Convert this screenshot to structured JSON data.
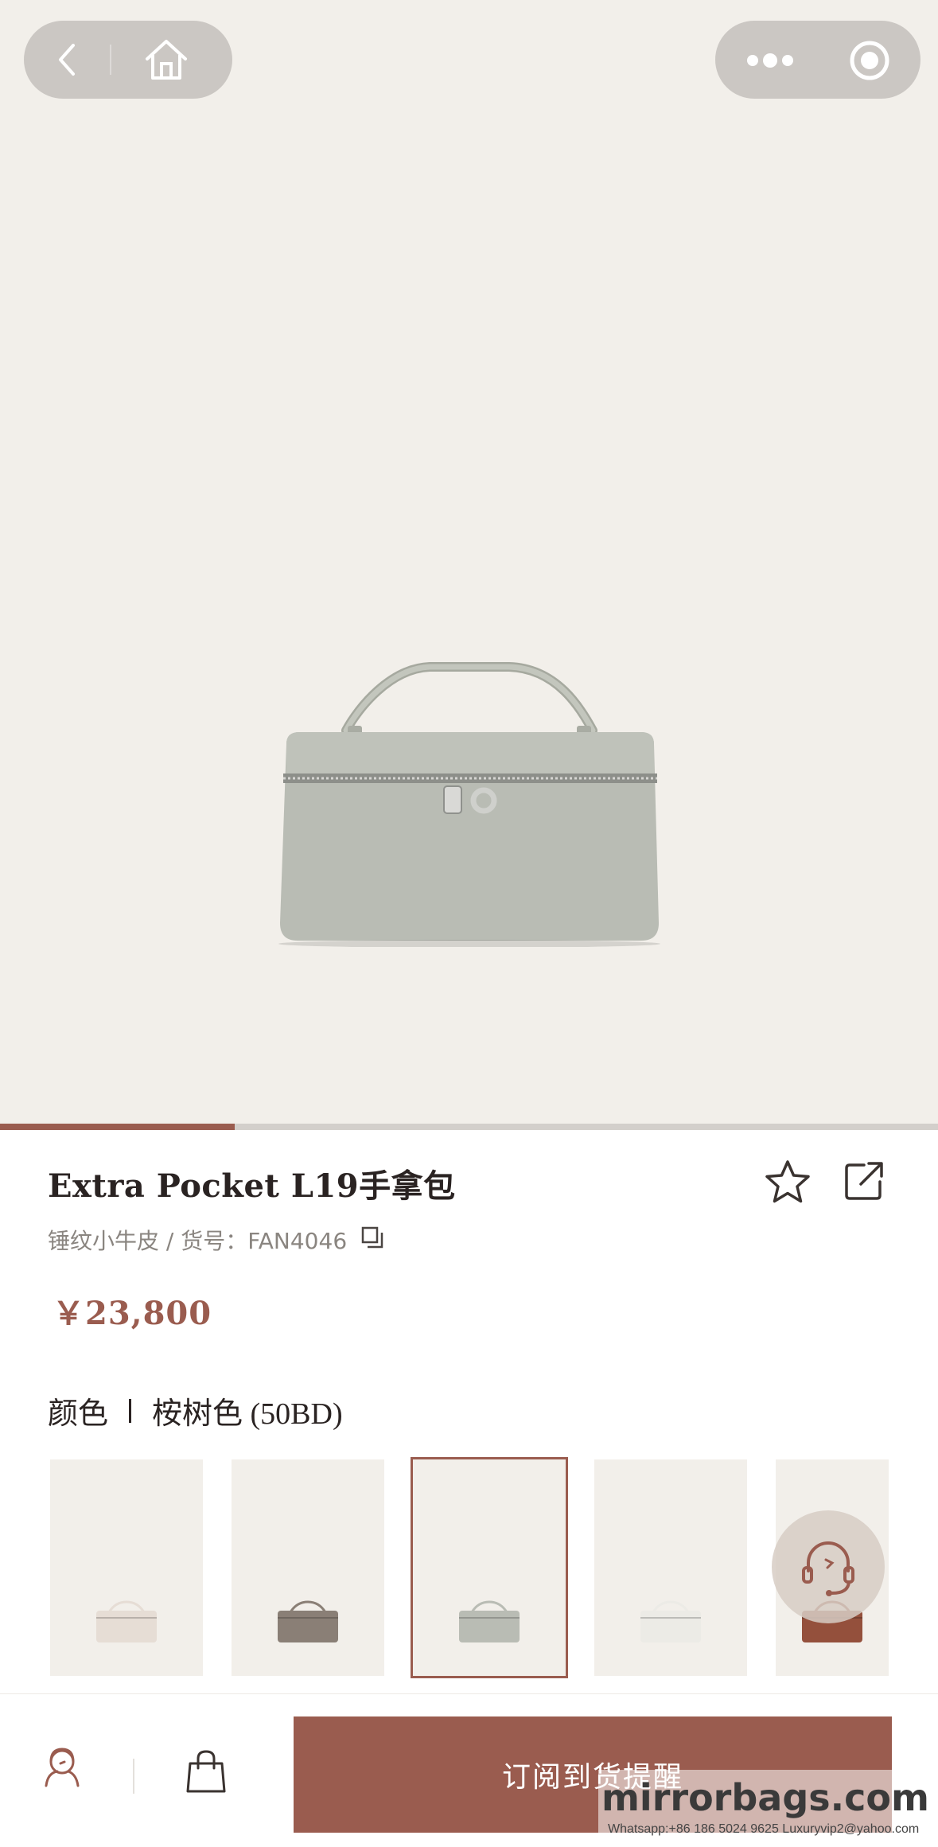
{
  "nav": {
    "back_icon": "chevron-left-icon",
    "home_icon": "home-icon",
    "more_icon": "more-dots-icon",
    "close_icon": "target-circle-icon"
  },
  "gallery": {
    "progress_fraction": 0.25,
    "product_color": "#b9bcb4"
  },
  "product": {
    "title": "Extra Pocket L19手拿包",
    "material": "锤纹小牛皮 / 货号：FAN4046",
    "price": "￥23,800",
    "color_heading": "颜色",
    "color_value": "桉树色 (50BD)"
  },
  "swatches": [
    {
      "color": "#e6ddd5",
      "selected": false
    },
    {
      "color": "#8a7f76",
      "selected": false
    },
    {
      "color": "#b9bcb4",
      "selected": true
    },
    {
      "color": "#ecebe6",
      "selected": false
    },
    {
      "color": "#94503c",
      "selected": false
    }
  ],
  "bottom_bar": {
    "service_icon": "customer-service-icon",
    "bag_icon": "shopping-bag-icon",
    "subscribe_label": "订阅到货提醒"
  },
  "watermark": {
    "brand": "mirrorbags.com",
    "contact": "Whatsapp:+86 186 5024 9625   Luxuryvip2@yahoo.com"
  },
  "colors": {
    "accent": "#9a5c4f",
    "background": "#f2efea"
  }
}
